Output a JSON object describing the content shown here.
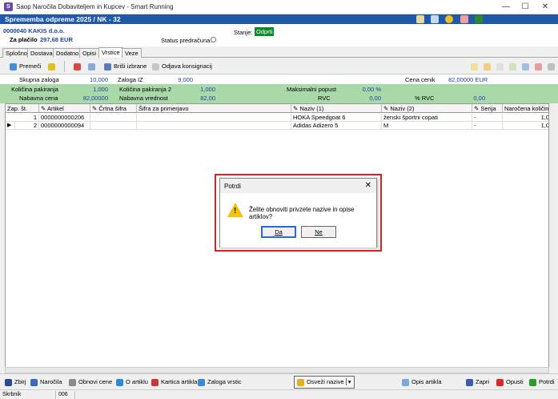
{
  "window": {
    "title": "Saop   Naročila Dobaviteljem in Kupcev - Smart Running",
    "app_icon": "S",
    "minimize": "—",
    "maximize": "☐",
    "close": "✕"
  },
  "header": {
    "title": "Sprememba odpreme 2025 / NK - 32"
  },
  "info": {
    "customer": "0000040 KAKIS d.o.o.",
    "za_placilo_label": "Za plačilo",
    "za_placilo_value": "297,68 EUR",
    "stanje_label": "Stanje:",
    "stanje_value": "Odprti",
    "status_label": "Status predračuna:"
  },
  "tabs": [
    "Splošno",
    "Dostava",
    "Dodatno",
    "Opisi",
    "Vrstice",
    "Veze"
  ],
  "active_tab": "Vrstice",
  "toolbar": {
    "premeci": "Premeči",
    "brisi": "Briši izbrane",
    "odjava": "Odjava konsignacij"
  },
  "summary": {
    "skupna_zaloga_label": "Skupna zaloga",
    "skupna_zaloga": "10,000",
    "zaloga_iz_label": "Zaloga IZ",
    "zaloga_iz": "9,000",
    "cena_cenik_label": "Cena cenik",
    "cena_cenik": "82,00000 EUR",
    "kol_pak_label": "Količina pakiranja",
    "kol_pak": "1,000",
    "kol_pak2_label": "Količina pakiranja 2",
    "kol_pak2": "1,000",
    "max_popust_label": "Maksimalni popust",
    "max_popust": "0,00 %",
    "nab_cena_label": "Nabavna cena",
    "nab_cena": "82,00000",
    "nab_vred_label": "Nabavna vrednost",
    "nab_vred": "82,00",
    "rvc_label": "RVC",
    "rvc": "0,00",
    "pct_rvc_label": "% RVC",
    "pct_rvc": "0,00"
  },
  "grid": {
    "columns": [
      "Zap. št.",
      "Artikel",
      "Črtna šifra",
      "Šifra za primerjavo",
      "Naziv (1)",
      "Naziv (2)",
      "Serija",
      "Naročena količina"
    ],
    "rows": [
      [
        "1",
        "0000000000206",
        "",
        "",
        "HOKA Speedgoat 6",
        "ženski športni copati",
        "-",
        "1,0"
      ],
      [
        "2",
        "0000000000094",
        "",
        "",
        "Adidas Adizero 5",
        "M",
        "-",
        "1,0"
      ]
    ]
  },
  "bottom": {
    "zbirj": "Zbirj",
    "narocila": "Naročila",
    "obnovi_cene": "Obnovi cene",
    "o_artiklu": "O artiklu",
    "kartica": "Kartica artikla",
    "zaloga": "Zaloga vrstic",
    "osvezi": "Osveži nazive",
    "osvezi_arrow": "▾",
    "opis": "Opis artikla",
    "zapri": "Zapri",
    "opusti": "Opusti",
    "potrdi": "Potrdi"
  },
  "status": {
    "user": "Skrbnik",
    "code": "006"
  },
  "dialog": {
    "title": "Potrdi",
    "close": "✕",
    "message": "Želite obnoviti privzete nazive in opise artiklov?",
    "warning_mark": "!",
    "yes": "Da",
    "no": "Ne"
  },
  "colors": {
    "header_bg": "#1f5aa8",
    "summary_green": "#a9d8a9",
    "value_blue": "#1f44a8",
    "status_green": "#0a8a2a",
    "dialog_highlight": "#e02020"
  }
}
